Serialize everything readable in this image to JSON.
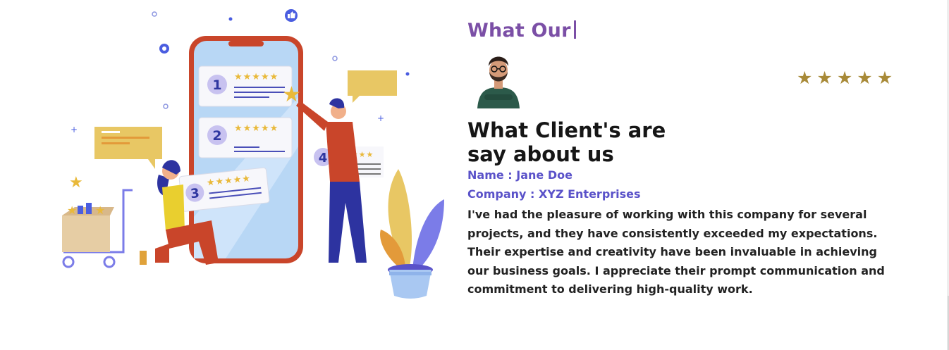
{
  "section": {
    "typing_heading": "What Our",
    "title_line1": "What Client's are",
    "title_line2": "say about us"
  },
  "testimonial": {
    "name": "Name : Jane Doe",
    "company": "Company : XYZ Enterprises",
    "rating": 5,
    "rating_max": 5,
    "star_glyph": "★",
    "text": "I've had the pleasure of working with this company for several projects, and they have consistently exceeded my expectations. Their expertise and creativity have been invaluable in achieving our business goals. I appreciate their prompt communication and commitment to delivering high-quality work."
  },
  "illustration": {
    "review_numbers": [
      "1",
      "2",
      "3",
      "4"
    ]
  },
  "colors": {
    "accent_purple": "#7b4fa6",
    "name_blue": "#5a52c9",
    "star_gold": "#a88a38"
  }
}
